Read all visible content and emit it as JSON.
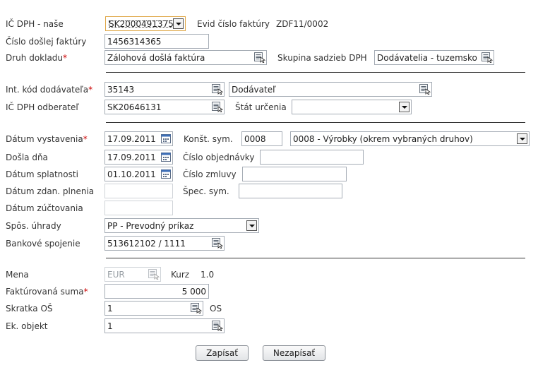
{
  "labels": {
    "ic_dph_nase": "IČ DPH - naše",
    "cislo_doslej": "Číslo došlej faktúry",
    "druh_dokladu": "Druh dokladu",
    "skupina_sadzieb": "Skupina sadzieb DPH",
    "evid_cislo": "Evid číslo faktúry",
    "int_kod": "Int. kód dodávateľa",
    "ic_dph_odberatel": "IČ DPH odberateľ",
    "stat_urcenia": "Štát určenia",
    "datum_vystavenia": "Dátum vystavenia",
    "konst_sym": "Konšt. sym.",
    "dosla_dna": "Došla dňa",
    "cislo_objednavky": "Číslo objednávky",
    "datum_splatnosti": "Dátum splatnosti",
    "cislo_zmluvy": "Číslo zmluvy",
    "datum_zdan": "Dátum zdan. plnenia",
    "spec_sym": "Špec. sym.",
    "datum_zuct": "Dátum zúčtovania",
    "spos_uhrady": "Spôs. úhrady",
    "bankove": "Bankové spojenie",
    "mena": "Mena",
    "kurz": "Kurz",
    "fakturovana": "Faktúrovaná suma",
    "skratka_os": "Skratka OŠ",
    "ek_objekt": "Ek. objekt",
    "required_mark": "*"
  },
  "values": {
    "ic_dph_nase": "SK2000491375",
    "evid_cislo": "ZDF11/0002",
    "cislo_doslej": "1456314365",
    "druh_dokladu": "Zálohová došlá faktúra",
    "skupina_sadzieb": "Dodávatelia - tuzemsko",
    "int_kod": "35143",
    "int_kod_name": "Dodávateľ",
    "ic_dph_odberatel": "SK20646131",
    "stat_urcenia": "",
    "datum_vystavenia": "17.09.2011",
    "konst_sym": "0008",
    "konst_sym_desc": "0008 - Výrobky (okrem vybraných druhov)",
    "dosla_dna": "17.09.2011",
    "cislo_objednavky": "",
    "datum_splatnosti": "01.10.2011",
    "cislo_zmluvy": "",
    "datum_zdan": "",
    "spec_sym": "",
    "datum_zuct": "",
    "spos_uhrady": "PP - Prevodný príkaz",
    "bankove": "513612102 / 1111",
    "mena": "EUR",
    "kurz": "1.0",
    "fakturovana": "5 000",
    "skratka_os": "1",
    "skratka_os_suffix": "OS",
    "ek_objekt": "1"
  },
  "buttons": {
    "zapisat": "Zapísať",
    "nezapisat": "Nezapísať"
  },
  "icons": {
    "picker": "lookup-picker-icon",
    "calendar": "calendar-icon",
    "dropdown": "chevron-down-icon"
  },
  "colors": {
    "required": "#cc0000",
    "field_border": "#a5acb5",
    "disabled_text": "#9aa0a6"
  }
}
